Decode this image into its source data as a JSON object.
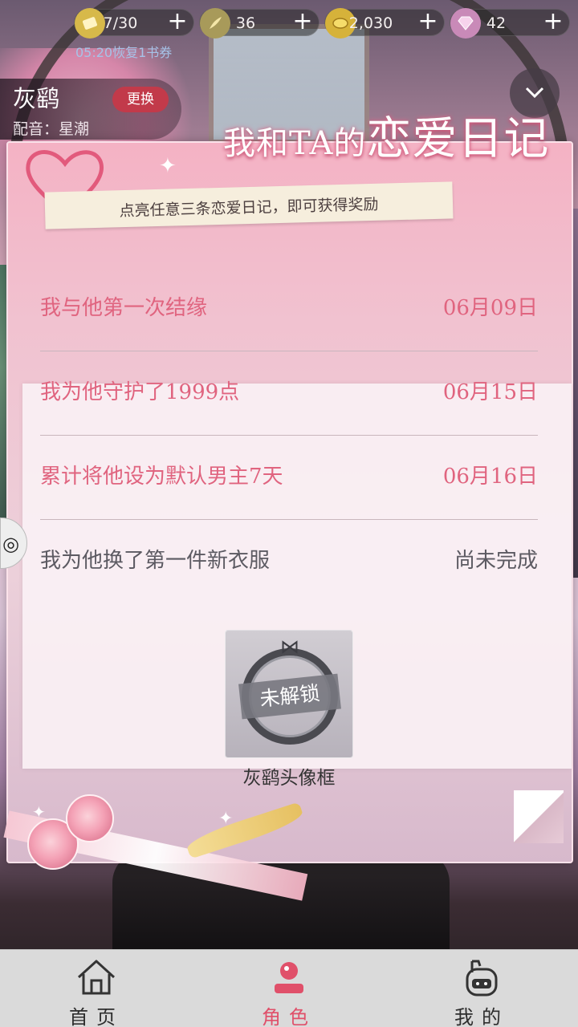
{
  "resources": [
    {
      "icon": "ticket-icon",
      "value": "7/30"
    },
    {
      "icon": "feather-icon",
      "value": "36"
    },
    {
      "icon": "coin-icon",
      "value": "2,030"
    },
    {
      "icon": "diamond-icon",
      "value": "42"
    }
  ],
  "recover_text": "05:20恢复1书券",
  "character": {
    "name": "灰鹞",
    "voice": "配音：星潮",
    "change_label": "更换"
  },
  "diary": {
    "title_prefix": "我和TA的",
    "title_main": "恋爱日记",
    "hint": "点亮任意三条恋爱日记，即可获得奖励",
    "entries": [
      {
        "label": "我与他第一次结缘",
        "date": "06月09日"
      },
      {
        "label": "我为他守护了1999点",
        "date": "06月15日"
      },
      {
        "label": "累计将他设为默认男主7天",
        "date": "06月16日"
      },
      {
        "label": "我为他换了第一件新衣服",
        "date": "尚未完成"
      }
    ],
    "reward": {
      "locked_tag": "未解锁",
      "name": "灰鹞头像框"
    }
  },
  "nav": [
    {
      "label": "首页",
      "icon": "home-icon",
      "active": false
    },
    {
      "label": "角色",
      "icon": "character-icon",
      "active": true
    },
    {
      "label": "我的",
      "icon": "profile-icon",
      "active": false
    }
  ],
  "colors": {
    "accent": "#e0647f",
    "active_nav": "#e0506a",
    "change_button": "#c23a4a"
  }
}
